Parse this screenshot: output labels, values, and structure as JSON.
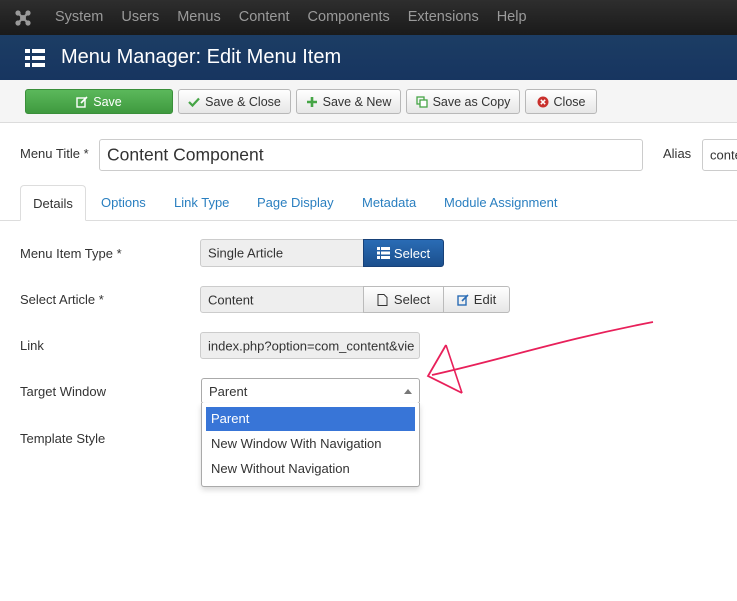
{
  "topnav": {
    "items": [
      "System",
      "Users",
      "Menus",
      "Content",
      "Components",
      "Extensions",
      "Help"
    ]
  },
  "header": {
    "title": "Menu Manager: Edit Menu Item"
  },
  "toolbar": {
    "save": "Save",
    "save_close": "Save & Close",
    "save_new": "Save & New",
    "save_copy": "Save as Copy",
    "close": "Close"
  },
  "form": {
    "menu_title_label": "Menu Title *",
    "menu_title_value": "Content Component",
    "alias_label": "Alias",
    "alias_value": "conte"
  },
  "tabs": [
    "Details",
    "Options",
    "Link Type",
    "Page Display",
    "Metadata",
    "Module Assignment"
  ],
  "details": {
    "menu_item_type_label": "Menu Item Type *",
    "menu_item_type_value": "Single Article",
    "select_label": "Select",
    "select_article_label": "Select Article *",
    "select_article_value": "Content",
    "select_button": "Select",
    "edit_button": "Edit",
    "link_label": "Link",
    "link_value": "index.php?option=com_content&vie",
    "target_window_label": "Target Window",
    "target_window_value": "Parent",
    "template_style_label": "Template Style"
  },
  "target_window_options": [
    "Parent",
    "New Window With Navigation",
    "New Without Navigation"
  ],
  "colors": {
    "save_green": "#46a546",
    "primary_blue": "#2a6cb5",
    "title_bar": "#1c3d64",
    "option_highlight": "#3875d7",
    "annotation_arrow": "#e8205a"
  }
}
